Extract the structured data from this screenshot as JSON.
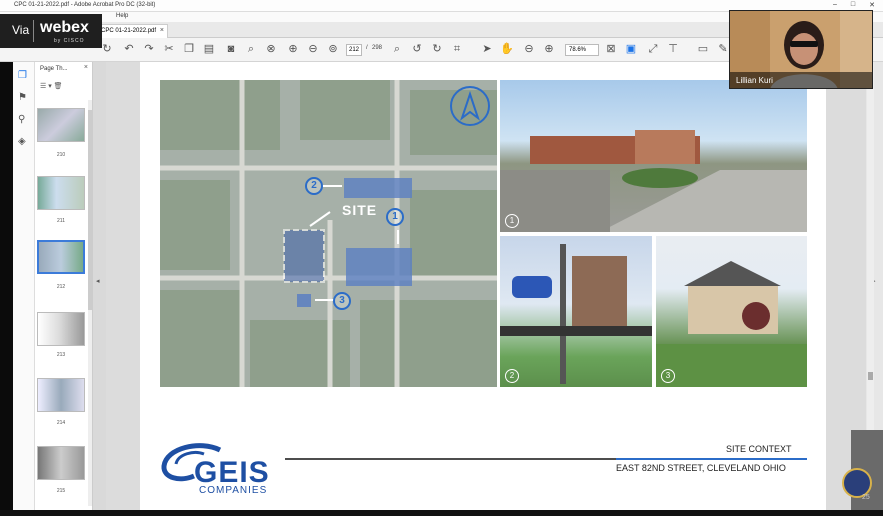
{
  "window": {
    "title": "CPC 01-21-2022.pdf - Adobe Acrobat Pro DC (32-bit)",
    "min": "–",
    "max": "□",
    "close": "✕"
  },
  "menu": {
    "help": "Help"
  },
  "tab": {
    "label": "CPC 01-21-2022.pdf",
    "close": "×"
  },
  "toolbar": {
    "page_current": "212",
    "page_separator": "/",
    "page_total": "298",
    "zoom": "78.6%"
  },
  "thumbnails": {
    "header": "Page Th...",
    "close": "×",
    "items": [
      {
        "label": "210"
      },
      {
        "label": "211"
      },
      {
        "label": "212"
      },
      {
        "label": "213"
      },
      {
        "label": "214"
      },
      {
        "label": "215"
      }
    ]
  },
  "webex": {
    "via": "Via",
    "brand": "webex",
    "sub": "by CISCO"
  },
  "video": {
    "participant": "Lillian Kuri"
  },
  "slide": {
    "site_label": "SITE",
    "map_markers": [
      "1",
      "2",
      "3"
    ],
    "photo_numbers": [
      "1",
      "2",
      "3"
    ],
    "heading": "SITE CONTEXT",
    "address": "EAST 82ND STREET, CLEVELAND OHIO",
    "logo_main": "GEIS",
    "logo_sub": "COMPANIES"
  },
  "page_badge": "25",
  "colors": {
    "accent": "#2b6cc8",
    "brand": "#1e4fa3"
  },
  "icons": [
    "home-icon",
    "bookmark-icon",
    "attachment-icon",
    "layers-icon",
    "save-icon",
    "print-icon",
    "search-icon",
    "undo-icon",
    "redo-icon",
    "cut-icon",
    "copy-icon",
    "paste-icon",
    "screenshot-icon",
    "find-icon",
    "prev-page-icon",
    "next-page-icon",
    "select-icon",
    "hand-icon",
    "zoom-out-icon",
    "zoom-in-icon",
    "comment-icon",
    "pen-icon",
    "sign-icon"
  ]
}
